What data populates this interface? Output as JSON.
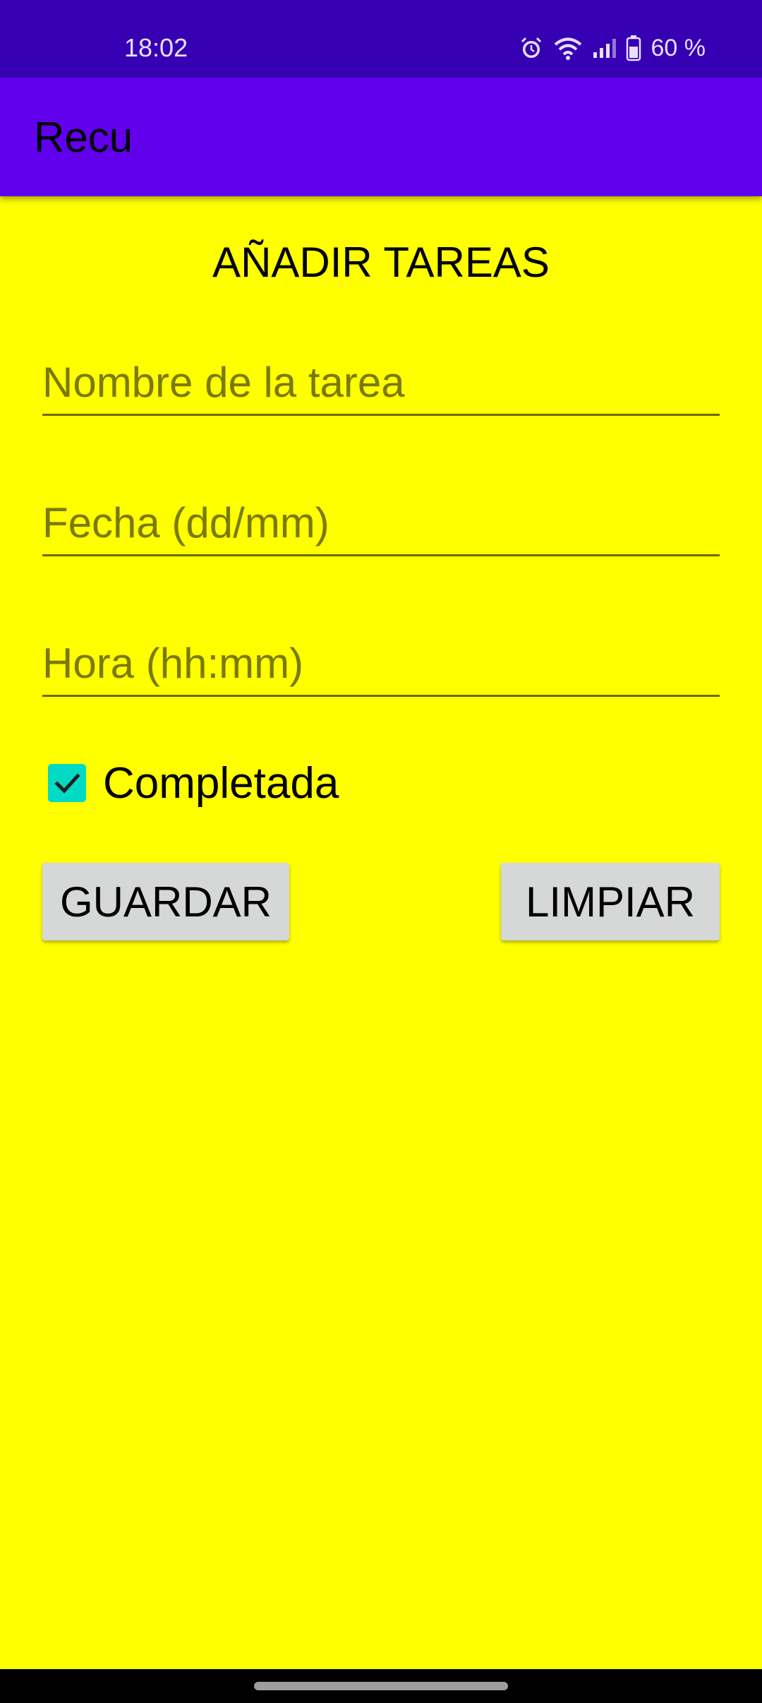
{
  "status_bar": {
    "time": "18:02",
    "battery": "60 %",
    "icons": [
      "alarm-icon",
      "wifi-icon",
      "signal-icon",
      "battery-icon"
    ]
  },
  "app_bar": {
    "title": "Recu"
  },
  "form": {
    "heading": "AÑADIR TAREAS",
    "fields": {
      "nombre": {
        "value": "",
        "placeholder": "Nombre de la tarea"
      },
      "fecha": {
        "value": "",
        "placeholder": "Fecha (dd/mm)"
      },
      "hora": {
        "value": "",
        "placeholder": "Hora (hh:mm)"
      }
    },
    "checkbox": {
      "label": "Completada",
      "checked": true
    },
    "buttons": {
      "save_label": "GUARDAR",
      "clear_label": "LIMPIAR"
    }
  },
  "colors": {
    "status_bar": "#3700B3",
    "app_bar": "#6200EE",
    "background": "#FFFF00",
    "checkbox_accent": "#03DAC5",
    "button": "#D6D7D7"
  }
}
